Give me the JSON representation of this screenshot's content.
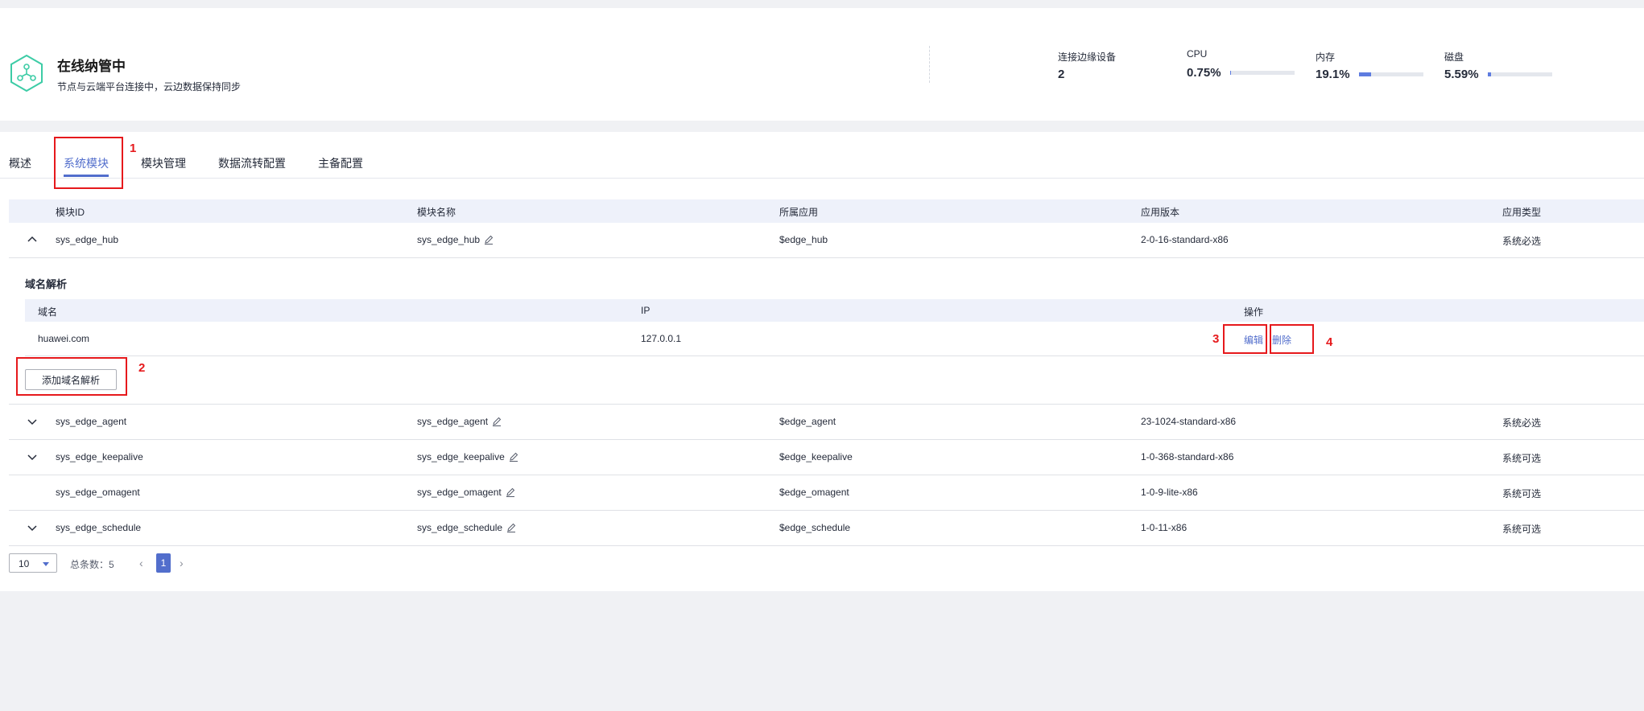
{
  "status": {
    "title": "在线纳管中",
    "description": "节点与云端平台连接中，云边数据保持同步",
    "icon": "hexagon-network-icon",
    "metrics": [
      {
        "label": "连接边缘设备",
        "value": "2"
      },
      {
        "label": "CPU",
        "value": "0.75%",
        "percent": 0.75
      },
      {
        "label": "内存",
        "value": "19.1%",
        "percent": 19.1
      },
      {
        "label": "磁盘",
        "value": "5.59%",
        "percent": 5.59
      }
    ]
  },
  "tabs": [
    "概述",
    "系统模块",
    "模块管理",
    "数据流转配置",
    "主备配置"
  ],
  "active_tab": "系统模块",
  "annotations": [
    "1",
    "2",
    "3",
    "4"
  ],
  "table": {
    "columns": [
      "模块ID",
      "模块名称",
      "所属应用",
      "应用版本",
      "应用类型"
    ],
    "rows": [
      {
        "id": "sys_edge_hub",
        "name": "sys_edge_hub",
        "app": "$edge_hub",
        "version": "2-0-16-standard-x86",
        "type": "系统必选"
      },
      {
        "id": "sys_edge_agent",
        "name": "sys_edge_agent",
        "app": "$edge_agent",
        "version": "23-1024-standard-x86",
        "type": "系统必选"
      },
      {
        "id": "sys_edge_keepalive",
        "name": "sys_edge_keepalive",
        "app": "$edge_keepalive",
        "version": "1-0-368-standard-x86",
        "type": "系统可选"
      },
      {
        "id": "sys_edge_omagent",
        "name": "sys_edge_omagent",
        "app": "$edge_omagent",
        "version": "1-0-9-lite-x86",
        "type": "系统可选"
      },
      {
        "id": "sys_edge_schedule",
        "name": "sys_edge_schedule",
        "app": "$edge_schedule",
        "version": "1-0-11-x86",
        "type": "系统可选"
      }
    ]
  },
  "dns": {
    "title": "域名解析",
    "columns": [
      "域名",
      "IP",
      "操作"
    ],
    "rows": [
      {
        "domain": "huawei.com",
        "ip": "127.0.0.1",
        "edit": "编辑",
        "delete": "删除"
      }
    ],
    "add_button": "添加域名解析"
  },
  "pagination": {
    "page_size": "10",
    "total": "总条数：5",
    "current_page": "1",
    "prev": "‹",
    "next": "›"
  },
  "colors": {
    "accent": "#526ecc",
    "annotation": "#e6191c",
    "status_icon": "#3dcca6"
  }
}
